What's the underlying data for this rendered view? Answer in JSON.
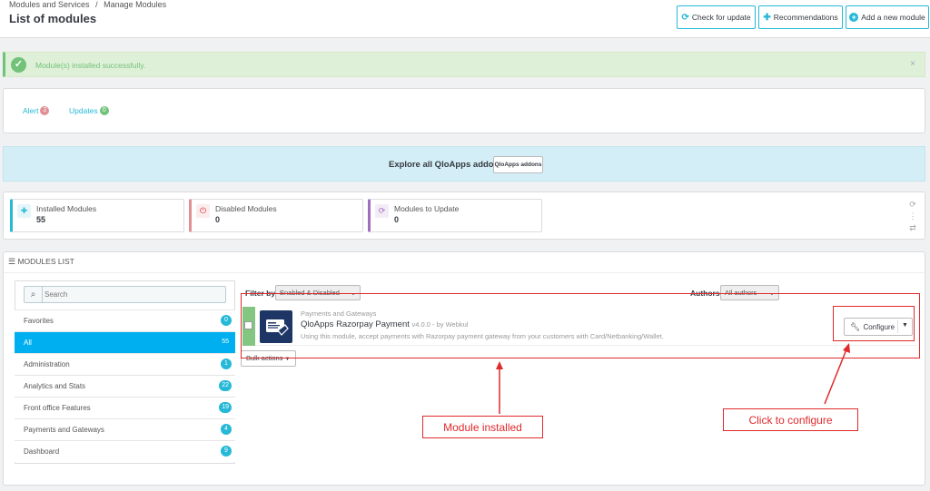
{
  "header": {
    "breadcrumb": [
      "Modules and Services",
      "Manage Modules"
    ],
    "breadcrumb_sep": "/",
    "title": "List of modules",
    "buttons": [
      {
        "label": "Check for update",
        "icon": "refresh-icon"
      },
      {
        "label": "Recommendations",
        "icon": "puzzle-icon"
      },
      {
        "label": "Add a new module",
        "icon": "plus-circle-icon"
      }
    ]
  },
  "alert": {
    "message": "Module(s) installed successfully.",
    "close": "×"
  },
  "tabs": [
    {
      "label": "Alert",
      "count": "2",
      "color": "#e08f95"
    },
    {
      "label": "Updates",
      "count": "0",
      "color": "#72c279"
    }
  ],
  "addons": {
    "text": "Explore all QloApps addons",
    "button": "QloApps addons"
  },
  "stats": [
    {
      "label": "Installed Modules",
      "value": "55",
      "color": "#25b9d7"
    },
    {
      "label": "Disabled Modules",
      "value": "0",
      "color": "#e08f95"
    },
    {
      "label": "Modules to Update",
      "value": "0",
      "color": "#a26dbd"
    }
  ],
  "modules_list": {
    "heading": "MODULES LIST",
    "search_placeholder": "Search",
    "categories": [
      {
        "label": "Favorites",
        "count": "0",
        "active": false
      },
      {
        "label": "All",
        "count": "55",
        "active": true
      },
      {
        "label": "Administration",
        "count": "1",
        "active": false
      },
      {
        "label": "Analytics and Stats",
        "count": "22",
        "active": false
      },
      {
        "label": "Front office Features",
        "count": "19",
        "active": false
      },
      {
        "label": "Payments and Gateways",
        "count": "4",
        "active": false
      },
      {
        "label": "Dashboard",
        "count": "9",
        "active": false
      }
    ],
    "filter_label": "Filter by",
    "filter_value": "Enabled & Disabled",
    "authors_label": "Authors",
    "authors_value": "All authors",
    "bulk_actions": "Bulk actions"
  },
  "module": {
    "category": "Payments and Gateways",
    "name": "QloApps Razorpay Payment",
    "version": "v4.0.0 - by Webkul",
    "description": "Using this module, accept payments with Razorpay payment gateway from your customers with Card/Netbanking/Wallet.",
    "configure": "Configure"
  },
  "annotations": {
    "module_installed": "Module installed",
    "click_to_configure": "Click to configure",
    "color": "#e0292b"
  }
}
